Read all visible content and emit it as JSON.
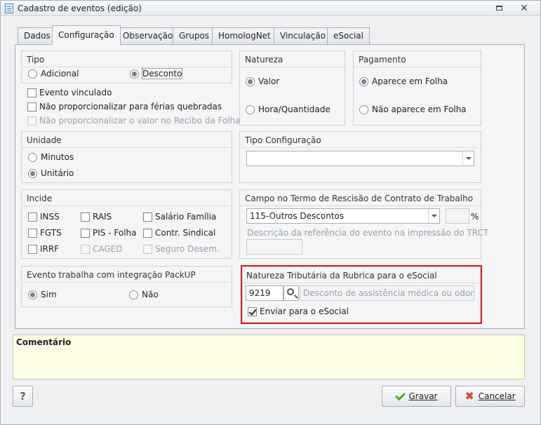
{
  "window": {
    "title": "Cadastro de eventos (edição)",
    "restore_icon": "restore-icon",
    "close_icon": "close-icon"
  },
  "tabs": [
    {
      "label": "Dados"
    },
    {
      "label": "Configuração",
      "active": true
    },
    {
      "label": "Observação"
    },
    {
      "label": "Grupos"
    },
    {
      "label": "HomologNet"
    },
    {
      "label": "Vinculação"
    },
    {
      "label": "eSocial"
    }
  ],
  "tipo": {
    "title": "Tipo",
    "options": [
      {
        "label": "Adicional",
        "selected": false
      },
      {
        "label": "Desconto",
        "selected": true
      }
    ]
  },
  "checks_top": [
    {
      "label": "Evento vinculado",
      "checked": false,
      "enabled": true
    },
    {
      "label": "Não proporcionalizar para férias quebradas",
      "checked": false,
      "enabled": true
    },
    {
      "label": "Não proporcionalizar o valor no Recibo da Folha",
      "checked": false,
      "enabled": false
    }
  ],
  "natureza": {
    "title": "Natureza",
    "options": [
      {
        "label": "Valor",
        "selected": true
      },
      {
        "label": "Hora/Quantidade",
        "selected": false
      }
    ]
  },
  "pagamento": {
    "title": "Pagamento",
    "options": [
      {
        "label": "Aparece em Folha",
        "selected": true
      },
      {
        "label": "Não aparece em Folha",
        "selected": false
      }
    ]
  },
  "unidade": {
    "title": "Unidade",
    "options": [
      {
        "label": "Minutos",
        "selected": false
      },
      {
        "label": "Unitário",
        "selected": true
      }
    ]
  },
  "tipo_config": {
    "title": "Tipo Configuração",
    "value": ""
  },
  "incide": {
    "title": "Incide",
    "items": [
      {
        "label": "INSS",
        "checked": false,
        "enabled": true
      },
      {
        "label": "RAIS",
        "checked": false,
        "enabled": true
      },
      {
        "label": "Salário Família",
        "checked": false,
        "enabled": true
      },
      {
        "label": "FGTS",
        "checked": false,
        "enabled": true
      },
      {
        "label": "PIS - Folha",
        "checked": false,
        "enabled": true
      },
      {
        "label": "Contr. Sindical",
        "checked": false,
        "enabled": true
      },
      {
        "label": "IRRF",
        "checked": false,
        "enabled": true
      },
      {
        "label": "CAGED",
        "checked": false,
        "enabled": false
      },
      {
        "label": "Seguro Desem.",
        "checked": false,
        "enabled": false
      }
    ]
  },
  "trct": {
    "title": "Campo no Termo de Rescisão de Contrato de Trabalho",
    "value": "115-Outros Descontos",
    "percent_value": "",
    "percent_symbol": "%",
    "desc_label": "Descrição da referência do evento na impressão do TRCT",
    "desc_value": ""
  },
  "packup": {
    "title": "Evento trabalha com integração PackUP",
    "options": [
      {
        "label": "Sim",
        "selected": true
      },
      {
        "label": "Não",
        "selected": false
      }
    ]
  },
  "esocial": {
    "title": "Natureza Tributária da Rubrica para o eSocial",
    "code": "9219",
    "description": "Desconto de assistência médica ou odontológica",
    "send_label": "Enviar para o eSocial",
    "send_checked": true
  },
  "comment": {
    "label": "Comentário"
  },
  "buttons": {
    "help": "?",
    "ok": "Gravar",
    "cancel": "Cancelar"
  },
  "colors": {
    "highlight": "#e0161d",
    "comment_bg": "#fcfde3",
    "ok_icon": "#58a72c",
    "cancel_icon": "#d8432c"
  }
}
